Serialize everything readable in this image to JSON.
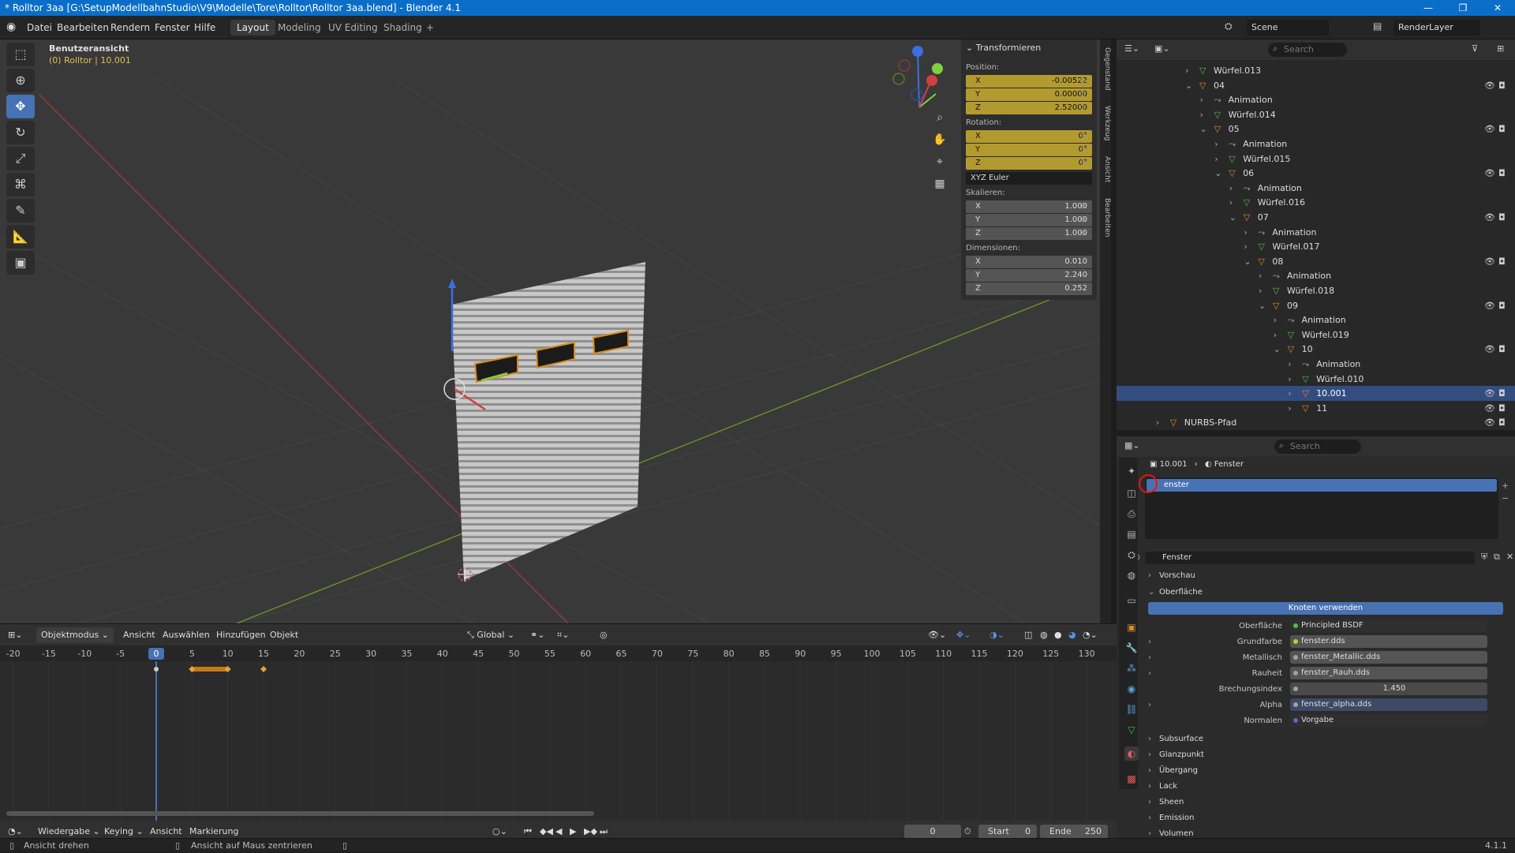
{
  "window": {
    "title": "* Rolltor 3aa [G:\\SetupModellbahnStudio\\V9\\Modelle\\Tore\\Rolltor\\Rolltor 3aa.blend] - Blender 4.1",
    "controls": [
      "—",
      "❐",
      "✕"
    ]
  },
  "menu": {
    "items": [
      "Datei",
      "Bearbeiten",
      "Rendern",
      "Fenster",
      "Hilfe"
    ],
    "workspaces": [
      "Layout",
      "Modeling",
      "UV Editing",
      "Shading",
      "+"
    ],
    "scene_label": "Scene",
    "viewlayer_label": "RenderLayer"
  },
  "viewport": {
    "view_name": "Benutzeransicht",
    "object_info": "(0) Rolltor | 10.001",
    "colors": {
      "bg": "#393939",
      "grid": "#444444",
      "axis_x": "#a33a3a",
      "axis_y": "#6a9a2a"
    }
  },
  "tools": [
    "select-box",
    "cursor",
    "move",
    "rotate",
    "scale",
    "transform",
    "annotate",
    "measure",
    "add-cube"
  ],
  "npanel": {
    "header": "Transformieren",
    "position_label": "Position:",
    "position": [
      {
        "axis": "X",
        "value": "-0.00522"
      },
      {
        "axis": "Y",
        "value": "0.00000"
      },
      {
        "axis": "Z",
        "value": "2.52000"
      }
    ],
    "rotation_label": "Rotation:",
    "rotation": [
      {
        "axis": "X",
        "value": "0°"
      },
      {
        "axis": "Y",
        "value": "0°"
      },
      {
        "axis": "Z",
        "value": "0°"
      }
    ],
    "rotation_mode": "XYZ Euler",
    "scale_label": "Skalieren:",
    "scale": [
      {
        "axis": "X",
        "value": "1.000"
      },
      {
        "axis": "Y",
        "value": "1.000"
      },
      {
        "axis": "Z",
        "value": "1.000"
      }
    ],
    "dimensions_label": "Dimensionen:",
    "dimensions": [
      {
        "axis": "X",
        "value": "0.010"
      },
      {
        "axis": "Y",
        "value": "2.240"
      },
      {
        "axis": "Z",
        "value": "0.252"
      }
    ],
    "side_tabs": [
      "Gegenstand",
      "Werkzeug",
      "Ansicht",
      "Bearbeiten"
    ]
  },
  "outliner": {
    "search_placeholder": "Search",
    "rows": [
      {
        "label": "Würfel.013",
        "type": "mesh",
        "indent": 0,
        "expanded": false
      },
      {
        "label": "04",
        "type": "empty",
        "indent": 0,
        "expanded": true
      },
      {
        "label": "Animation",
        "type": "anim",
        "indent": 1,
        "expanded": false
      },
      {
        "label": "Würfel.014",
        "type": "mesh",
        "indent": 1,
        "expanded": false
      },
      {
        "label": "05",
        "type": "empty",
        "indent": 1,
        "expanded": true
      },
      {
        "label": "Animation",
        "type": "anim",
        "indent": 2,
        "expanded": false
      },
      {
        "label": "Würfel.015",
        "type": "mesh",
        "indent": 2,
        "expanded": false
      },
      {
        "label": "06",
        "type": "empty",
        "indent": 2,
        "expanded": true
      },
      {
        "label": "Animation",
        "type": "anim",
        "indent": 3,
        "expanded": false
      },
      {
        "label": "Würfel.016",
        "type": "mesh",
        "indent": 3,
        "expanded": false
      },
      {
        "label": "07",
        "type": "empty",
        "indent": 3,
        "expanded": true
      },
      {
        "label": "Animation",
        "type": "anim",
        "indent": 4,
        "expanded": false
      },
      {
        "label": "Würfel.017",
        "type": "mesh",
        "indent": 4,
        "expanded": false
      },
      {
        "label": "08",
        "type": "empty",
        "indent": 4,
        "expanded": true
      },
      {
        "label": "Animation",
        "type": "anim",
        "indent": 5,
        "expanded": false
      },
      {
        "label": "Würfel.018",
        "type": "mesh",
        "indent": 5,
        "expanded": false
      },
      {
        "label": "09",
        "type": "empty",
        "indent": 5,
        "expanded": true
      },
      {
        "label": "Animation",
        "type": "anim",
        "indent": 6,
        "expanded": false
      },
      {
        "label": "Würfel.019",
        "type": "mesh",
        "indent": 6,
        "expanded": false
      },
      {
        "label": "10",
        "type": "empty",
        "indent": 6,
        "expanded": true
      },
      {
        "label": "Animation",
        "type": "anim",
        "indent": 7,
        "expanded": false
      },
      {
        "label": "Würfel.010",
        "type": "mesh",
        "indent": 7,
        "expanded": false
      },
      {
        "label": "10.001",
        "type": "empty",
        "indent": 7,
        "expanded": false,
        "selected": true
      },
      {
        "label": "11",
        "type": "empty",
        "indent": 7,
        "expanded": false
      },
      {
        "label": "NURBS-Pfad",
        "type": "curve",
        "indent": -2,
        "expanded": false
      }
    ]
  },
  "properties": {
    "search_placeholder": "Search",
    "breadcrumb_object": "10.001",
    "breadcrumb_material": "Fenster",
    "slot_name": "enster",
    "material_name": "Fenster",
    "sections": {
      "preview": "Vorschau",
      "surface": "Oberfläche",
      "use_nodes": "Knoten verwenden"
    },
    "rows": [
      {
        "label": "Oberfläche",
        "value": "Principled BSDF",
        "dot": "#4cbf4c"
      },
      {
        "label": "Grundfarbe",
        "value": "fenster.dds",
        "dot": "#c7c729"
      },
      {
        "label": "Metallisch",
        "value": "fenster_Metallic.dds",
        "dot": "#a1a1a1"
      },
      {
        "label": "Rauheit",
        "value": "fenster_Rauh.dds",
        "dot": "#a1a1a1"
      },
      {
        "label": "Brechungsindex",
        "value": "1.450",
        "dot": "#a1a1a1"
      },
      {
        "label": "Alpha",
        "value": "fenster_alpha.dds",
        "dot": "#a1a1a1"
      },
      {
        "label": "Normalen",
        "value": "Vorgabe",
        "dot": "#6363c7"
      }
    ],
    "subsections": [
      "Subsurface",
      "Glanzpunkt",
      "Übergang",
      "Lack",
      "Sheen",
      "Emission",
      "Volumen"
    ]
  },
  "viewport_header": {
    "mode": "Objektmodus",
    "menus": [
      "Ansicht",
      "Auswählen",
      "Hinzufügen",
      "Objekt"
    ],
    "orientation": "Global"
  },
  "timeline": {
    "ticks": [
      "-20",
      "-15",
      "-10",
      "-5",
      "0",
      "5",
      "10",
      "15",
      "20",
      "25",
      "30",
      "35",
      "40",
      "45",
      "50",
      "55",
      "60",
      "65",
      "70",
      "75",
      "80",
      "85",
      "90",
      "95",
      "100",
      "105",
      "110",
      "115",
      "120",
      "125",
      "130"
    ],
    "current_frame": "0",
    "keyframes": [
      5,
      10,
      15
    ],
    "footer_menus": [
      "Wiedergabe",
      "Keying",
      "Ansicht",
      "Markierung"
    ],
    "frame_value": "0",
    "start_label": "Start",
    "start_value": "0",
    "end_label": "Ende",
    "end_value": "250"
  },
  "status": {
    "left": "Ansicht drehen",
    "middle": "Ansicht auf Maus zentrieren",
    "version": "4.1.1"
  }
}
